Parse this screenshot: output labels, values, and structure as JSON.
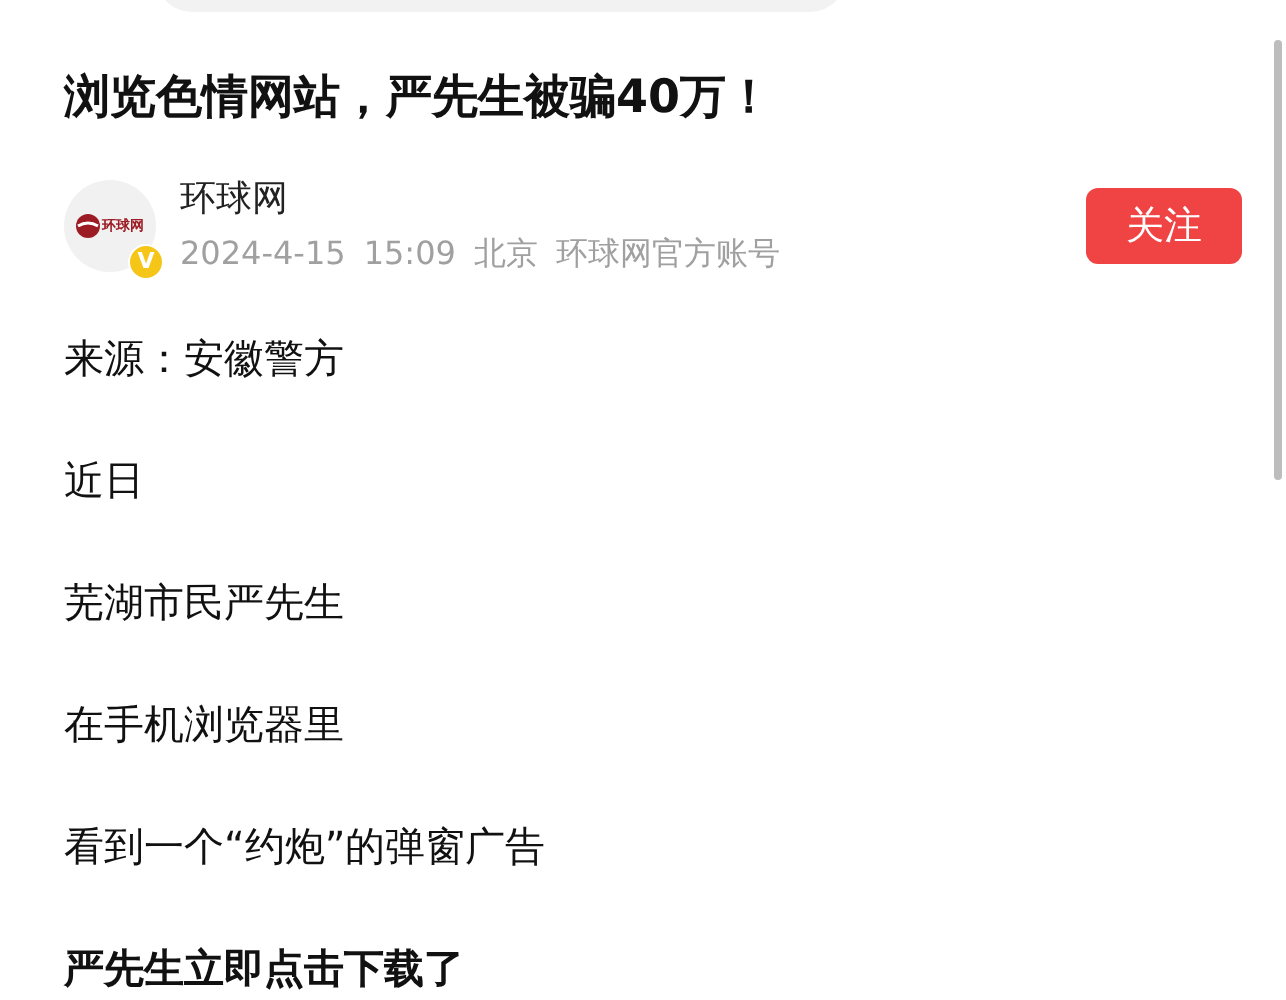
{
  "title": "浏览色情网站，严先生被骗40万！",
  "author": {
    "logo_text": "环球网",
    "verified_mark": "V",
    "name": "环球网",
    "date": "2024-4-15",
    "time": "15:09",
    "location": "北京",
    "account": "环球网官方账号"
  },
  "follow_button": "关注",
  "paragraphs": [
    {
      "text": "来源：安徽警方",
      "bold": false
    },
    {
      "text": "近日",
      "bold": false
    },
    {
      "text": "芜湖市民严先生",
      "bold": false
    },
    {
      "text": "在手机浏览器里",
      "bold": false
    },
    {
      "text": "看到一个“约炮”的弹窗广告",
      "bold": false
    },
    {
      "text": "严先生立即点击下载了",
      "bold": true
    }
  ]
}
